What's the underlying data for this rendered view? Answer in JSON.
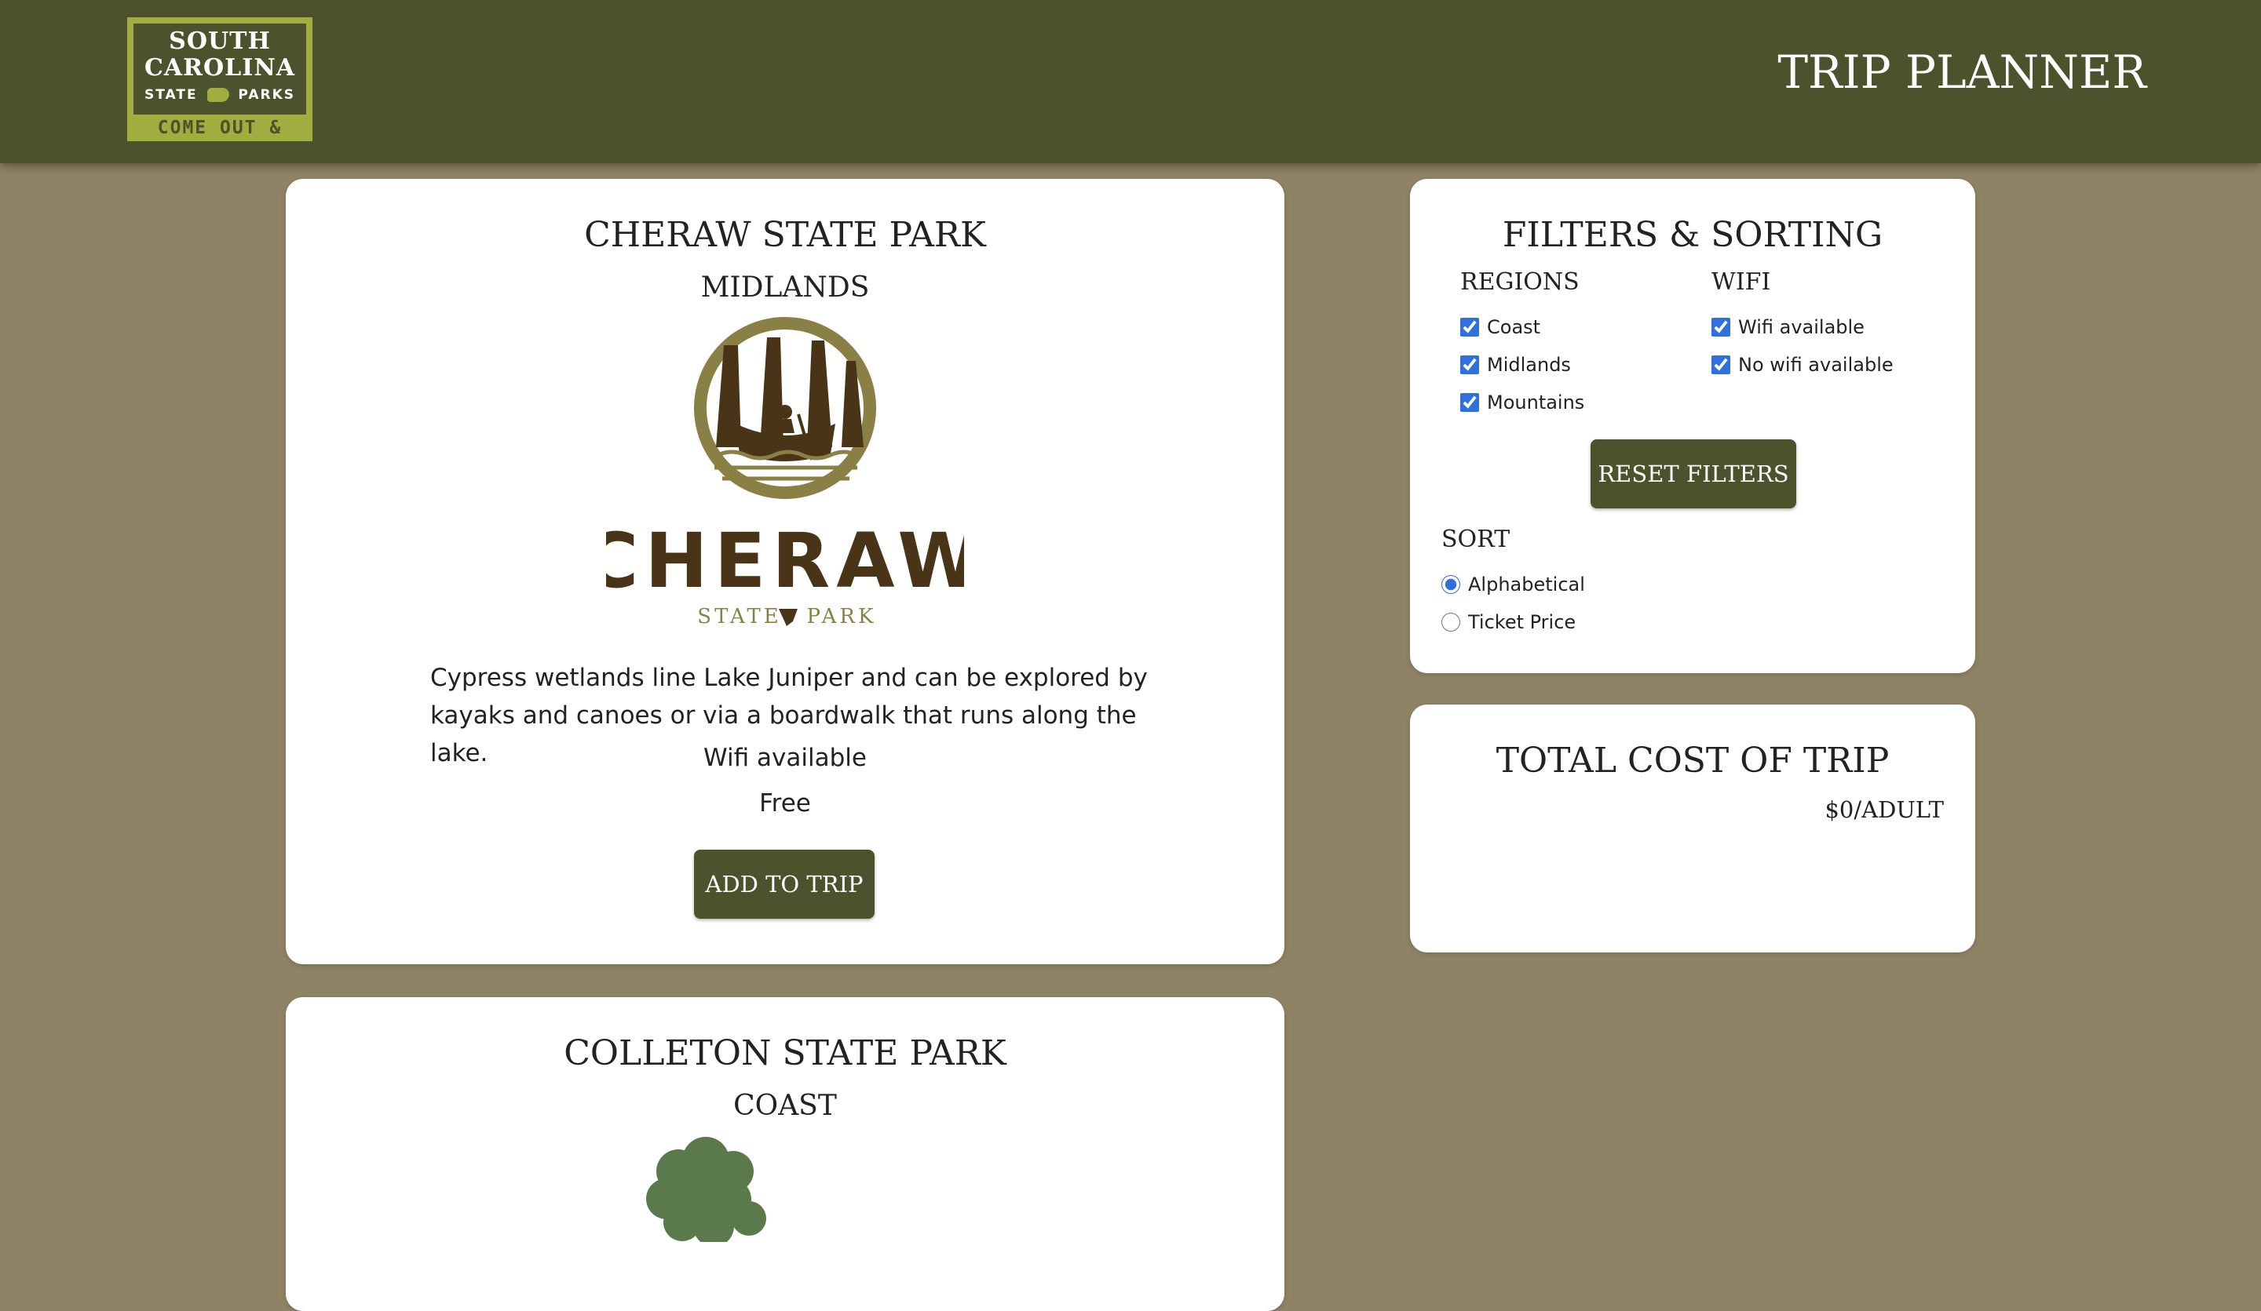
{
  "header": {
    "logo_line1": "SOUTH",
    "logo_line2": "CAROLINA",
    "logo_line3_left": "STATE",
    "logo_line3_right": "PARKS",
    "logo_tagline": "COME OUT & PLAY",
    "title": "TRIP PLANNER"
  },
  "parks": [
    {
      "name": "CHERAW STATE PARK",
      "region": "MIDLANDS",
      "logo_wordmark": "CHERAW",
      "logo_sub_left": "STATE",
      "logo_sub_right": "PARK",
      "description": "Cypress wetlands line Lake Juniper and can be explored by kayaks and canoes or via a boardwalk that runs along the lake.",
      "wifi": "Wifi available",
      "price": "Free",
      "button": "ADD TO TRIP"
    },
    {
      "name": "COLLETON STATE PARK",
      "region": "COAST"
    }
  ],
  "filters": {
    "title": "FILTERS & SORTING",
    "regions_heading": "REGIONS",
    "regions": [
      {
        "label": "Coast",
        "checked": true
      },
      {
        "label": "Midlands",
        "checked": true
      },
      {
        "label": "Mountains",
        "checked": true
      }
    ],
    "wifi_heading": "WIFI",
    "wifi": [
      {
        "label": "Wifi available",
        "checked": true
      },
      {
        "label": "No wifi available",
        "checked": true
      }
    ],
    "reset_button": "RESET FILTERS",
    "sort_heading": "SORT",
    "sort_options": [
      {
        "label": "Alphabetical",
        "selected": true
      },
      {
        "label": "Ticket Price",
        "selected": false
      }
    ]
  },
  "total": {
    "title": "TOTAL COST OF TRIP",
    "value": "$0/ADULT"
  },
  "colors": {
    "header_bg": "#4b522c",
    "page_bg": "#8f8265",
    "accent_logo": "#a2ad3f",
    "button_bg": "#4b522c",
    "cheraw_brown": "#4a3418",
    "cheraw_olive": "#8a7f45",
    "tree_green": "#5a7a4c"
  }
}
